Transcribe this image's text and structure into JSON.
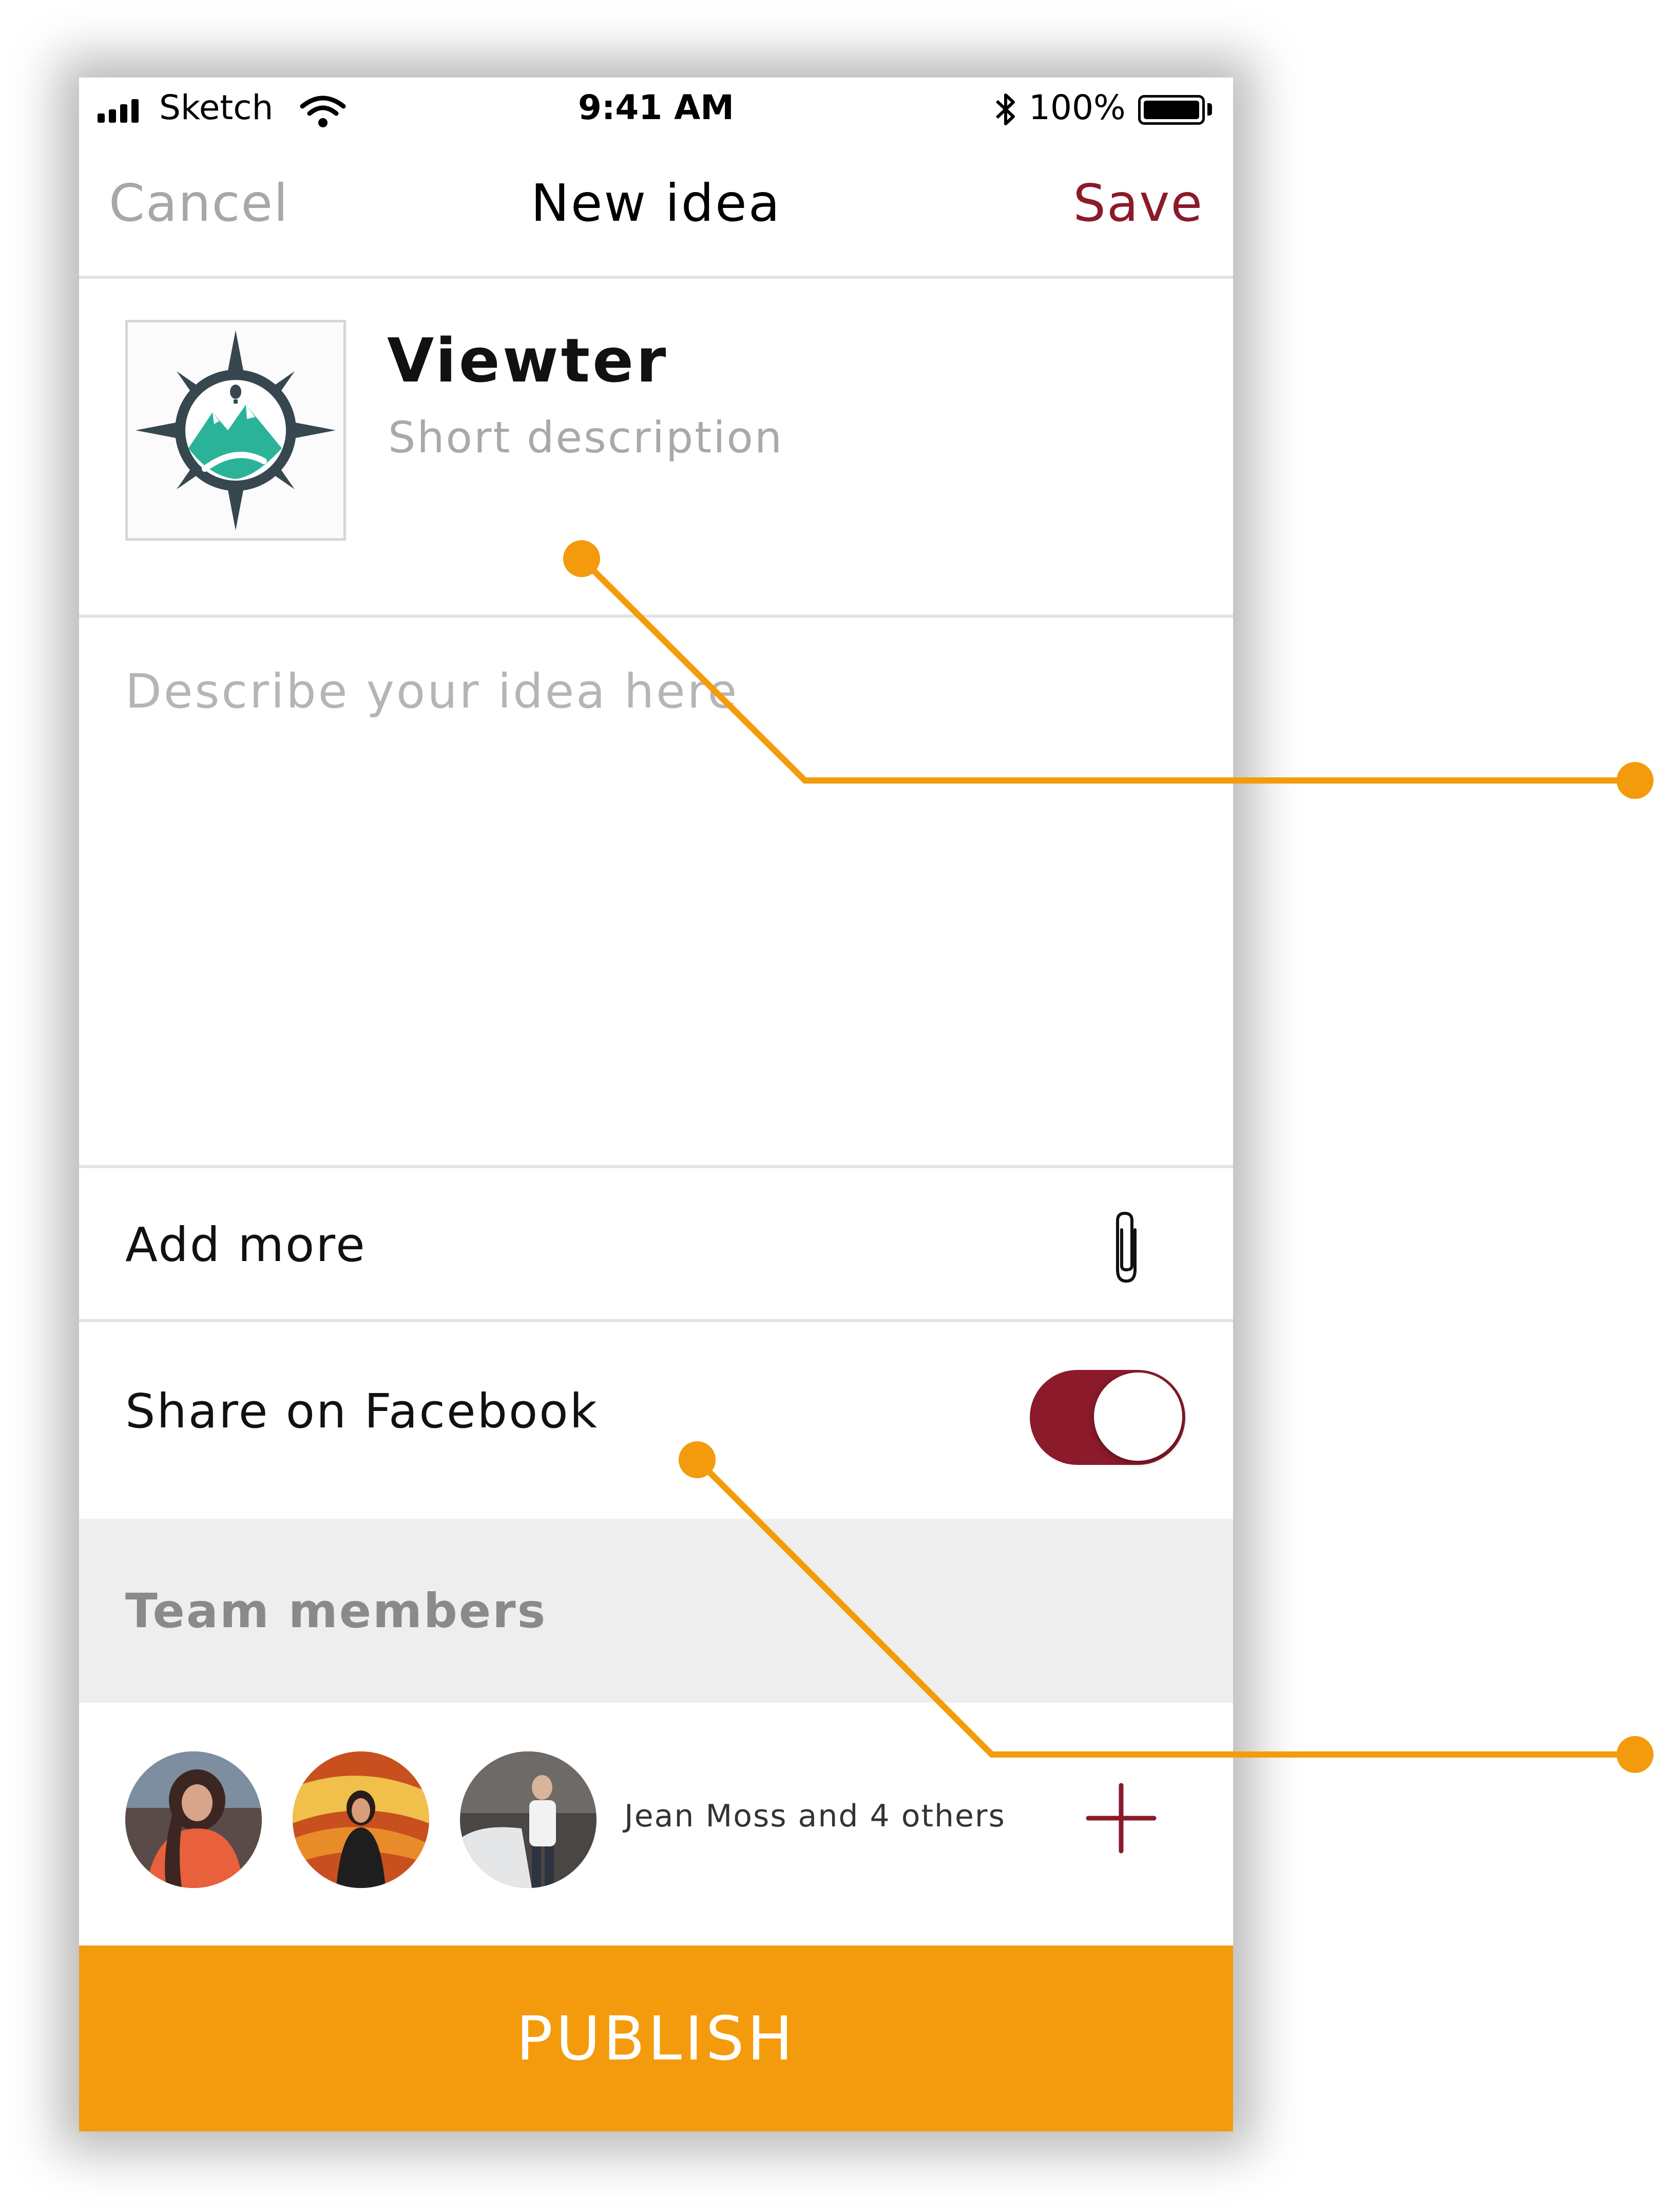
{
  "status_bar": {
    "carrier": "Sketch",
    "time": "9:41 AM",
    "battery": "100%",
    "battery_level": 1.0
  },
  "nav": {
    "cancel_label": "Cancel",
    "title": "New idea",
    "save_label": "Save"
  },
  "idea": {
    "title": "Viewter",
    "short_description_placeholder": "Short description",
    "description_placeholder": "Describe your idea here"
  },
  "attachments": {
    "label": "Add more",
    "icon": "paperclip-icon"
  },
  "share": {
    "label": "Share on Facebook",
    "enabled": true
  },
  "team": {
    "header": "Team members",
    "summary": "Jean Moss and 4 others",
    "add_icon": "plus-icon"
  },
  "publish_label": "PUBLISH",
  "colors": {
    "accent": "#8b1a2b",
    "publish": "#f39b0c",
    "callout": "#f39b0c",
    "section_bg": "#eeeeee"
  }
}
